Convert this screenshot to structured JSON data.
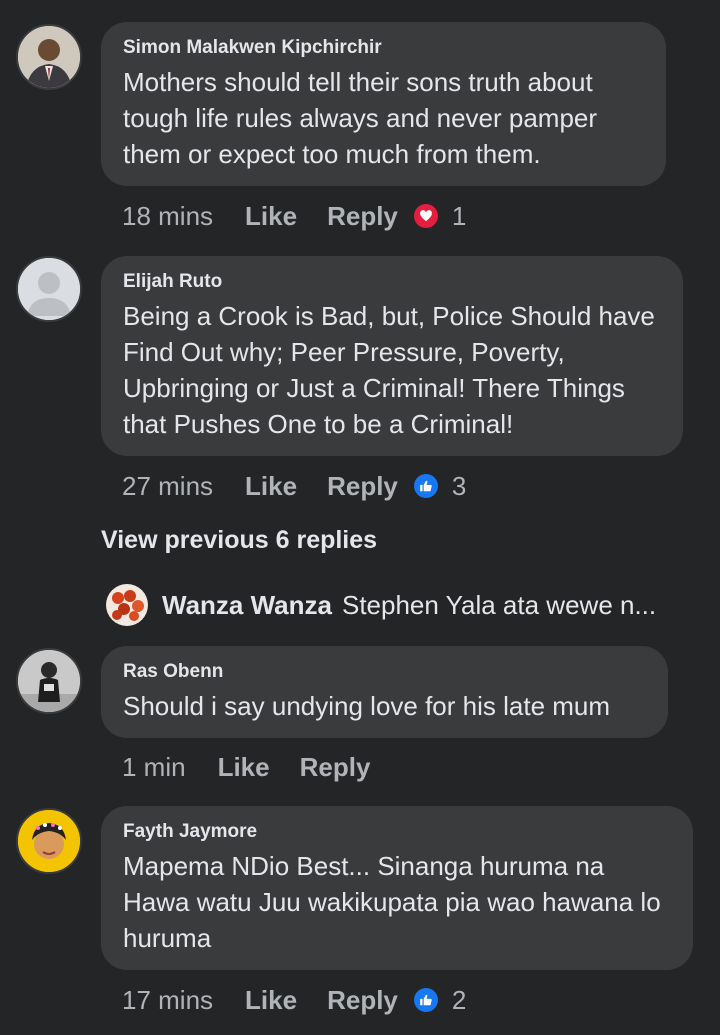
{
  "comments": [
    {
      "author": "Simon Malakwen Kipchirchir",
      "text": "Mothers should tell their sons  truth about tough life rules always and never pamper them or expect  too much from them.",
      "time": "18 mins",
      "like": "Like",
      "reply": "Reply",
      "reaction": "heart-icon",
      "reaction_color": "#e41e3f",
      "reaction_count": "1"
    },
    {
      "author": "Elijah Ruto",
      "text": "Being a Crook is Bad, but, Police Should have Find  Out why; Peer Pressure, Poverty, Upbringing or Just a Criminal! There Things that Pushes One to be a Criminal!",
      "time": "27 mins",
      "like": "Like",
      "reply": "Reply",
      "reaction": "thumbs-up-icon",
      "reaction_color": "#1877f2",
      "reaction_count": "3"
    },
    {
      "author": "Ras Obenn",
      "text": "Should i say undying love for his late mum",
      "time": "1 min",
      "like": "Like",
      "reply": "Reply"
    },
    {
      "author": "Fayth Jaymore",
      "text": "Mapema NDio Best... Sinanga huruma na Hawa watu Juu wakikupata pia wao hawana lo huruma",
      "time": "17 mins",
      "like": "Like",
      "reply": "Reply",
      "reaction": "thumbs-up-icon",
      "reaction_color": "#1877f2",
      "reaction_count": "2"
    }
  ],
  "view_previous": "View previous 6 replies",
  "reply_preview": {
    "author": "Wanza Wanza",
    "text": "Stephen Yala ata wewe n..."
  }
}
